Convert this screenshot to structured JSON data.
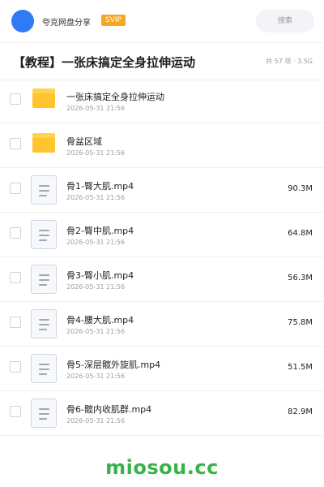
{
  "header": {
    "brand": "夸克网盘分享",
    "badge": "SVIP",
    "search_placeholder": "搜索"
  },
  "share": {
    "title": "【教程】一张床搞定全身拉伸运动",
    "meta": "共 57 项 · 3.5G"
  },
  "files": [
    {
      "type": "folder",
      "name": "一张床搞定全身拉伸运动",
      "date": "2026-05-31 21:56",
      "size": ""
    },
    {
      "type": "folder",
      "name": "骨盆区域",
      "date": "2026-05-31 21:56",
      "size": ""
    },
    {
      "type": "file",
      "name": "骨1-臀大肌.mp4",
      "date": "2026-05-31 21:56",
      "size": "90.3M"
    },
    {
      "type": "file",
      "name": "骨2-臀中肌.mp4",
      "date": "2026-05-31 21:56",
      "size": "64.8M"
    },
    {
      "type": "file",
      "name": "骨3-臀小肌.mp4",
      "date": "2026-05-31 21:56",
      "size": "56.3M"
    },
    {
      "type": "file",
      "name": "骨4-腰大肌.mp4",
      "date": "2026-05-31 21:56",
      "size": "75.8M"
    },
    {
      "type": "file",
      "name": "骨5-深层髋外旋肌.mp4",
      "date": "2026-05-31 21:56",
      "size": "51.5M"
    },
    {
      "type": "file",
      "name": "骨6-髋内收肌群.mp4",
      "date": "2026-05-31 21:56",
      "size": "82.9M"
    }
  ],
  "watermark": "miosou.cc",
  "colors": {
    "accent": "#2f7bf6",
    "svip": "#f6a623",
    "folder": "#ffc52e",
    "watermark": "#38b34a"
  }
}
